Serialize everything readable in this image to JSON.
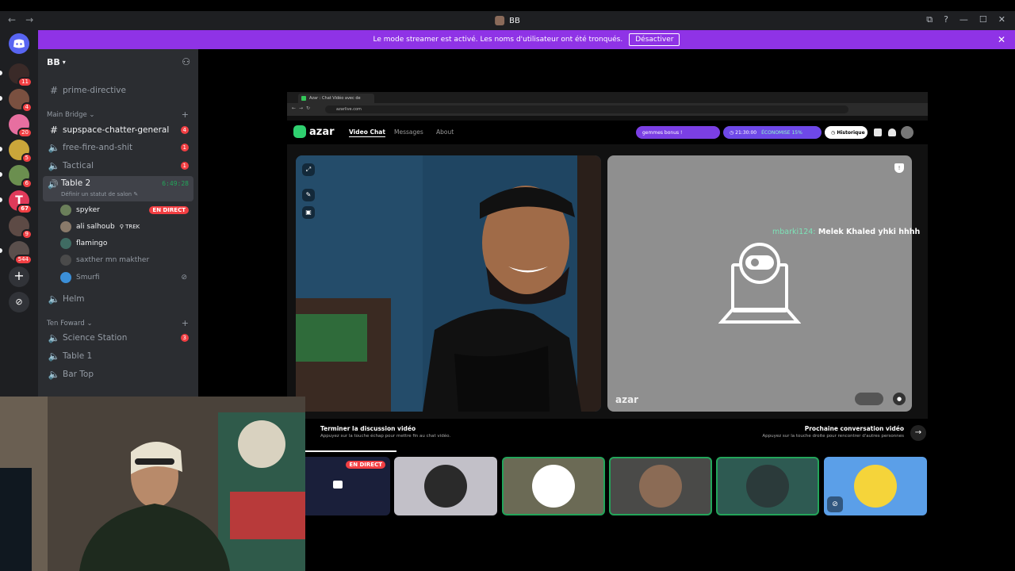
{
  "window": {
    "title": "BB",
    "nav_back": "←",
    "nav_forward": "→",
    "controls": [
      "⧉",
      "?",
      "—",
      "☐",
      "✕"
    ]
  },
  "banner": {
    "text": "Le mode streamer est activé. Les noms d'utilisateur ont été tronqués.",
    "button": "Désactiver",
    "close": "✕"
  },
  "rail": {
    "badges": [
      "11",
      "4",
      "20",
      "5",
      "6",
      "67",
      "9",
      "544"
    ],
    "add": "+",
    "explore": "⊘"
  },
  "server": {
    "name": "BB",
    "add_user_icon": "⚇"
  },
  "channels": {
    "top_text": [
      "prime-directive"
    ],
    "main_bridge": {
      "label": "Main Bridge",
      "items": [
        {
          "name": "supspace-chatter-general",
          "count": "4"
        },
        {
          "name": "free-fire-and-shit",
          "count": "1"
        },
        {
          "name": "Tactical",
          "count": "1"
        }
      ]
    },
    "active": {
      "name": "Table 2",
      "timer": "6:49:28",
      "status": "Définir un statut de salon ✎"
    },
    "voice_users": [
      {
        "name": "spyker",
        "live": "EN DIRECT"
      },
      {
        "name": "ali salhoub",
        "tag": "TREK"
      },
      {
        "name": "flamingo"
      },
      {
        "name": "saxther mn makther"
      },
      {
        "name": "Smurfi"
      }
    ],
    "helm": "Helm",
    "ten_foward": {
      "label": "Ten Foward",
      "items": [
        {
          "name": "Science Station",
          "count": "3"
        },
        {
          "name": "Table 1"
        },
        {
          "name": "Bar Top"
        }
      ]
    }
  },
  "browser": {
    "tab_title": "Azar : Chat Vidéo avec de",
    "url": "azarlive.com",
    "nav": {
      "video_chat": "Video Chat",
      "messages": "Messages",
      "about": "About",
      "gems": "gemmes bonus !",
      "time": "21:30:00",
      "save": "ÉCONOMISE 15%",
      "history": "Historique"
    },
    "chat_user": "mbarki124:",
    "chat_text": "Melek Khaled yhki hhhh",
    "watermark": "azar",
    "footer": {
      "end_title": "Terminer la discussion vidéo",
      "end_sub": "Appuyez sur la touche échap pour mettre fin au chat vidéo.",
      "next_title": "Prochaine conversation vidéo",
      "next_sub": "Appuyez sur la touche droite pour rencontrer d'autres personnes"
    }
  },
  "tiles": {
    "live": "EN DIRECT"
  }
}
